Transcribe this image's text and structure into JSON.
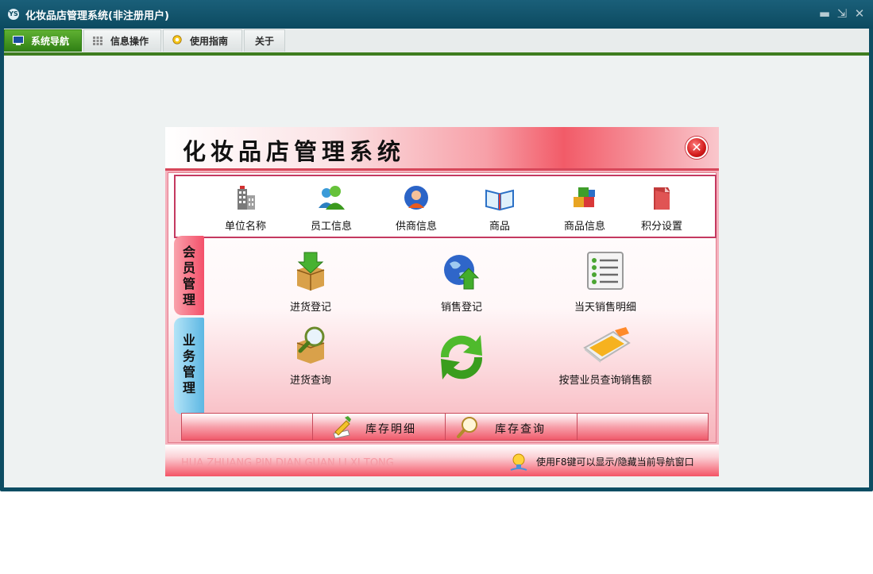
{
  "window": {
    "title": "化妆品店管理系统(非注册用户)",
    "controls": {
      "minimize": "▬",
      "restore": "⇲",
      "close": "✕"
    }
  },
  "menu": {
    "tabs": [
      {
        "label": "系统导航",
        "icon": "monitor-icon",
        "active": true
      },
      {
        "label": "信息操作",
        "icon": "grid-icon",
        "active": false
      },
      {
        "label": "使用指南",
        "icon": "guide-icon",
        "active": false
      },
      {
        "label": "关于",
        "icon": "",
        "active": false
      }
    ]
  },
  "panel": {
    "title": "化妆品店管理系统",
    "close_symbol": "✕",
    "top_items": [
      {
        "label": "单位名称",
        "icon": "building-icon"
      },
      {
        "label": "员工信息",
        "icon": "users-icon"
      },
      {
        "label": "供商信息",
        "icon": "supplier-icon"
      },
      {
        "label": "商品",
        "icon": "book-icon"
      },
      {
        "label": "商品信息",
        "icon": "boxes-icon"
      },
      {
        "label": "积分设置",
        "icon": "folder-icon"
      }
    ],
    "side_tabs": [
      {
        "label": "会员管理",
        "color": "red"
      },
      {
        "label": "业务管理",
        "color": "blue"
      }
    ],
    "main_items": [
      {
        "label": "进货登记",
        "icon": "box-down-icon"
      },
      {
        "label": "销售登记",
        "icon": "globe-up-icon"
      },
      {
        "label": "当天销售明细",
        "icon": "list-icon"
      },
      {
        "label": "进货查询",
        "icon": "box-search-icon"
      },
      {
        "label": "",
        "icon": "refresh-icon"
      },
      {
        "label": "按营业员查询销售额",
        "icon": "laptop-icon"
      }
    ],
    "bottom_buttons": [
      {
        "label": "库存明细",
        "icon": "pencil-icon"
      },
      {
        "label": "库存查询",
        "icon": "magnifier-icon"
      }
    ],
    "footer_text": "HUA ZHUANG PIN DIAN GUAN LI XI TONG",
    "footer_hint": "使用F8键可以显示/隐藏当前导航窗口"
  },
  "colors": {
    "titlebar": "#0c4a60",
    "accent_green": "#3e7d1f",
    "panel_red": "#f25b68",
    "side_blue": "#5cb7e3"
  }
}
